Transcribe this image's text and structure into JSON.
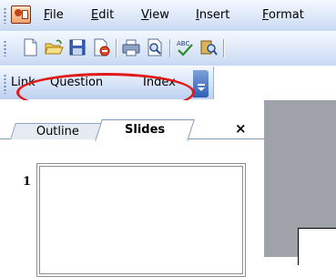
{
  "menubar": {
    "items": [
      {
        "label": "File"
      },
      {
        "label": "Edit"
      },
      {
        "label": "View"
      },
      {
        "label": "Insert"
      },
      {
        "label": "Format"
      }
    ]
  },
  "toolbar": {
    "buttons": [
      "new-icon",
      "open-icon",
      "save-icon",
      "permission-icon",
      "print-icon",
      "print-preview-icon",
      "spelling-icon",
      "research-icon"
    ]
  },
  "custom_toolbar": {
    "buttons": [
      {
        "label": "Link"
      },
      {
        "label": "Question"
      },
      {
        "label": "Index"
      }
    ]
  },
  "pane": {
    "tabs": [
      {
        "label": "Outline"
      },
      {
        "label": "Slides"
      }
    ],
    "close_label": "×",
    "slide_number": "1"
  },
  "colors": {
    "highlight": "#e01919",
    "toolbar_gradient_top": "#f4f8fe",
    "toolbar_gradient_bottom": "#c9d9f3",
    "workspace": "#9fa2a8"
  }
}
